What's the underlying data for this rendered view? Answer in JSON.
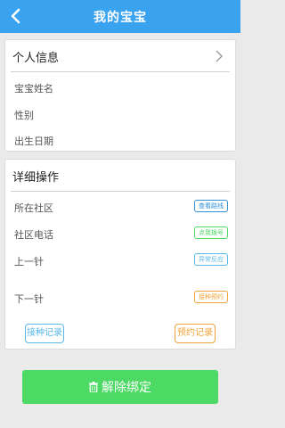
{
  "header": {
    "title": "我的宝宝"
  },
  "personal": {
    "heading": "个人信息",
    "rows": [
      "宝宝姓名",
      "性别",
      "出生日期"
    ]
  },
  "details": {
    "heading": "详细操作",
    "rows": [
      {
        "label": "所在社区",
        "action": "查看路线",
        "color": "#2f8fd8"
      },
      {
        "label": "社区电话",
        "action": "点我拨号",
        "color": "#4cd964"
      },
      {
        "label": "上一针",
        "action": "异常反应",
        "color": "#5ab8e8"
      },
      {
        "label": "下一针",
        "action": "接种预约",
        "color": "#f0a33a"
      }
    ],
    "record_left": "接种记录",
    "record_right": "预约记录",
    "record_left_color": "#5ab8e8",
    "record_right_color": "#f0a33a"
  },
  "unbind": {
    "label": "解除绑定"
  },
  "colors": {
    "primary": "#3aa3f0",
    "green": "#4cd964"
  }
}
